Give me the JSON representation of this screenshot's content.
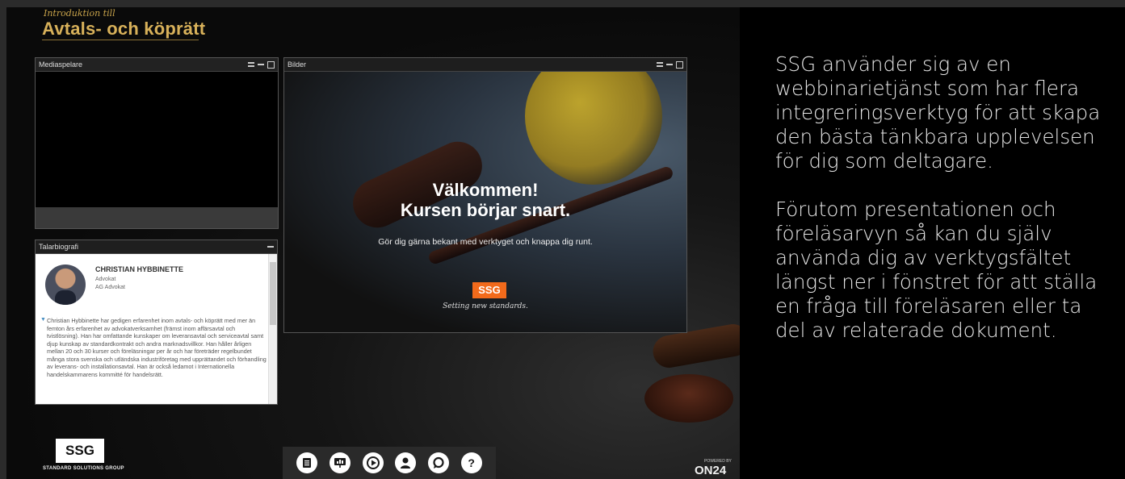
{
  "brand": {
    "script": "Introduktion till",
    "title": "Avtals- och köprätt"
  },
  "media_panel": {
    "title": "Mediaspelare"
  },
  "slides_panel": {
    "title": "Bilder",
    "slide": {
      "heading1": "Välkommen!",
      "heading2": "Kursen börjar snart.",
      "subtitle": "Gör dig gärna bekant med verktyget och knappa dig runt.",
      "logo": "SSG",
      "tagline": "Setting new standards."
    }
  },
  "bio_panel": {
    "title": "Talarbiografi",
    "name": "CHRISTIAN HYBBINETTE",
    "role": "Advokat",
    "company": "AG Advokat",
    "text": "Christian Hybbinette har gedigen erfarenhet inom avtals- och köprätt med mer än femton års erfarenhet av advokatverksamhet (främst inom affärsavtal och tvistlösning). Han har omfattande kunskaper om leveransavtal och serviceavtal samt djup kunskap av standardkontrakt och andra marknadsvillkor. Han håller årligen mellan 20 och 30 kurser och föreläsningar per år och har företräder regelbundet många stora svenska och utländska industriföretag med upprättandet och förhandling av leverans- och installationsavtal. Han är också ledamot i Internationella handelskammarens kommitté för handelsrätt."
  },
  "toolbar": {
    "items": [
      {
        "name": "resources",
        "icon": "document-icon"
      },
      {
        "name": "slides",
        "icon": "presentation-icon"
      },
      {
        "name": "media",
        "icon": "play-icon"
      },
      {
        "name": "speaker",
        "icon": "person-icon"
      },
      {
        "name": "chat",
        "icon": "chat-icon"
      },
      {
        "name": "help",
        "icon": "question-icon",
        "glyph": "?"
      }
    ]
  },
  "footer": {
    "ssg_logo": "SSG",
    "ssg_sub": "STANDARD SOLUTIONS GROUP",
    "powered_by": "POWERED BY",
    "on24": "ON24"
  },
  "info": {
    "paragraph1": "SSG använder sig av en webbinarietjänst som har flera integreringsverktyg för att skapa den bästa tänkbara upplevelsen för dig som deltagare.",
    "paragraph2": "Förutom presentationen och föreläsarvyn så kan du själv använda dig av verktygsfältet längst ner i fönstret för att ställa en fråga till föreläsaren eller ta del av relaterade dokument."
  },
  "colors": {
    "gold": "#d8b15a",
    "ssg_orange": "#f26a1b"
  }
}
